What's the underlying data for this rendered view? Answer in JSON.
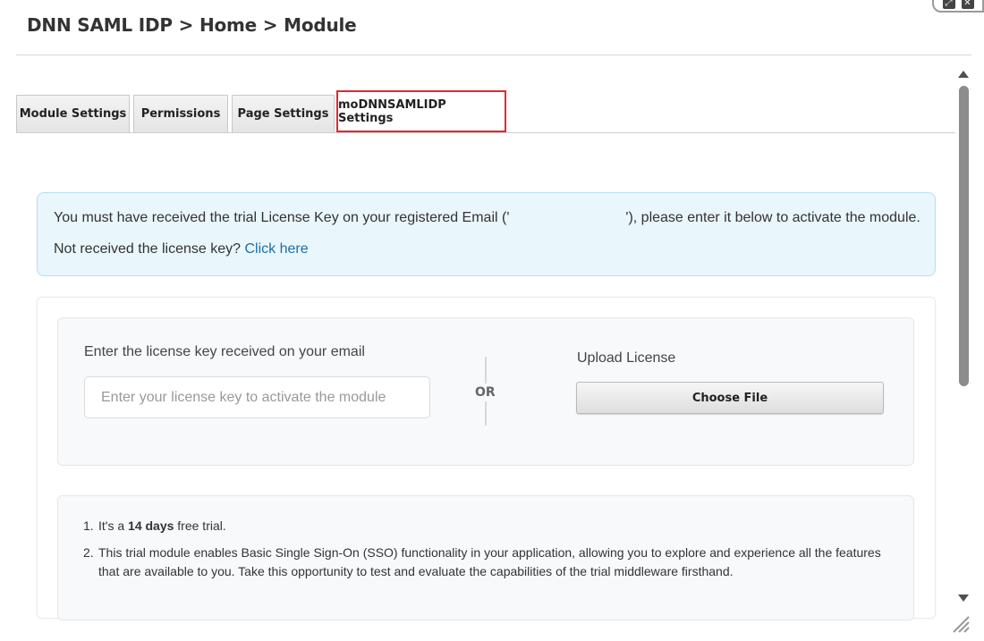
{
  "breadcrumb": {
    "part1": "DNN SAML IDP",
    "sep1": ">",
    "part2": "Home",
    "sep2": ">",
    "part3": "Module"
  },
  "tabs": [
    {
      "label": "Module Settings"
    },
    {
      "label": "Permissions"
    },
    {
      "label": "Page Settings"
    },
    {
      "label": "moDNNSAMLIDP Settings",
      "active": true
    }
  ],
  "alert": {
    "line1_before": "You must have received the trial License Key on your registered Email ('",
    "line1_after": "'), please enter it below to activate the module.",
    "line2_text": "Not received the license key?",
    "line2_link": "Click here"
  },
  "license": {
    "key_label": "Enter the license key received on your email",
    "key_placeholder": "Enter your license key to activate the module",
    "key_value": "",
    "or_label": "OR",
    "upload_label": "Upload License",
    "choose_file_label": "Choose File"
  },
  "info": {
    "item1_num": "1.",
    "item1_prefix": "It's a",
    "item1_bold": "14 days",
    "item1_suffix": "free trial.",
    "item2_num": "2.",
    "item2_text": "This trial module enables Basic Single Sign-On (SSO) functionality in your application, allowing you to explore and experience all the features that are available to you. Take this opportunity to test and evaluate the capabilities of the trial middleware firsthand."
  },
  "colors": {
    "active_tab_border": "#e0282e",
    "alert_bg": "#e9f6fb",
    "link": "#1a6fa8"
  },
  "icons": [
    "expand-icon",
    "close-icon",
    "scroll-up-icon",
    "scroll-down-icon",
    "resize-grip-icon"
  ]
}
